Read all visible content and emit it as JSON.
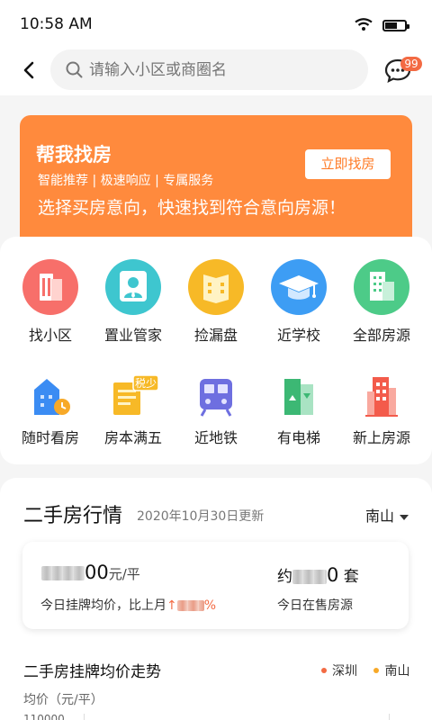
{
  "status_bar": {
    "time": "10:58 AM"
  },
  "topbar": {
    "search_placeholder": "请输入小区或商圈名",
    "message_badge": "99"
  },
  "banner": {
    "title": "帮我找房",
    "tags": "智能推荐 | 极速响应 | 专属服务",
    "slogan": "选择买房意向，快速找到符合意向房源！",
    "button_label": "立即找房"
  },
  "grid": {
    "items": [
      {
        "label": "找小区",
        "icon": "building-icon",
        "color": "#f76f6a"
      },
      {
        "label": "置业管家",
        "icon": "agent-icon",
        "color": "#3ec6cf"
      },
      {
        "label": "捡漏盘",
        "icon": "book-icon",
        "color": "#f7b927"
      },
      {
        "label": "近学校",
        "icon": "graduation-cap-icon",
        "color": "#3d9df4"
      },
      {
        "label": "全部房源",
        "icon": "office-icon",
        "color": "#4dcb88"
      },
      {
        "label": "随时看房",
        "icon": "house-clock-icon",
        "color": "#3b8cf3"
      },
      {
        "label": "房本满五",
        "icon": "certificate-icon",
        "color": "#f7b927",
        "tag": "税少"
      },
      {
        "label": "近地铁",
        "icon": "subway-icon",
        "color": "#6e6fe0"
      },
      {
        "label": "有电梯",
        "icon": "elevator-icon",
        "color": "#3cb874"
      },
      {
        "label": "新上房源",
        "icon": "new-building-icon",
        "color": "#f35b4b"
      }
    ]
  },
  "market": {
    "title": "二手房行情",
    "updated": "2020年10月30日更新",
    "region": "南山",
    "price_tail": "00",
    "price_unit": "元/平",
    "price_note_prefix": "今日挂牌均价，比上月",
    "price_note_arrow": "↑",
    "price_note_suffix": "%",
    "count_prefix": "约",
    "count_tail": "0",
    "count_unit": "套",
    "count_note": "今日在售房源",
    "trend_title": "二手房挂牌均价走势",
    "legend": [
      {
        "label": "深圳",
        "color": "#f36a43"
      },
      {
        "label": "南山",
        "color": "#f7a928"
      }
    ],
    "ylabel": "均价（元/平）",
    "ytick": "110000"
  },
  "colors": {
    "accent": "#ff8a3d",
    "badge": "#f36a43"
  }
}
